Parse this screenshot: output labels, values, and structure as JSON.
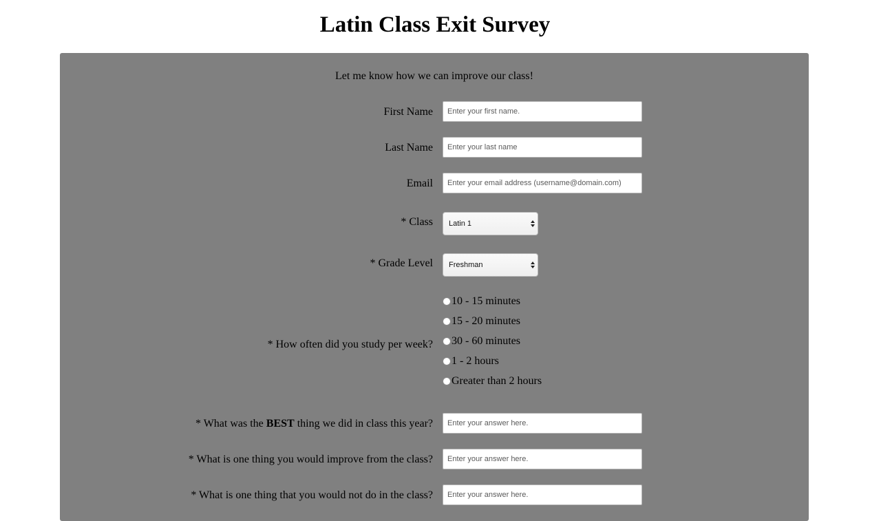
{
  "page": {
    "title": "Latin Class Exit Survey",
    "intro": "Let me know how we can improve our class!"
  },
  "fields": {
    "first_name": {
      "label": "First Name",
      "placeholder": "Enter your first name."
    },
    "last_name": {
      "label": "Last Name",
      "placeholder": "Enter your last name"
    },
    "email": {
      "label": "Email",
      "placeholder": "Enter your email address (username@domain.com)"
    },
    "class": {
      "label": "* Class",
      "value": "Latin 1"
    },
    "grade": {
      "label": "* Grade Level",
      "value": "Freshman"
    },
    "study": {
      "label": "* How often did you study per week?",
      "options": [
        "10 - 15 minutes",
        "15 - 20 minutes",
        "30 - 60 minutes",
        "1 - 2 hours",
        "Greater than 2 hours"
      ]
    },
    "best": {
      "label_prefix": "* What was the ",
      "label_bold": "BEST",
      "label_suffix": " thing we did in class this year?",
      "placeholder": "Enter your answer here."
    },
    "improve": {
      "label": "* What is one thing you would improve from the class?",
      "placeholder": "Enter your answer here."
    },
    "not_do": {
      "label": "* What is one thing that you would not do in the class?",
      "placeholder": "Enter your answer here."
    }
  }
}
